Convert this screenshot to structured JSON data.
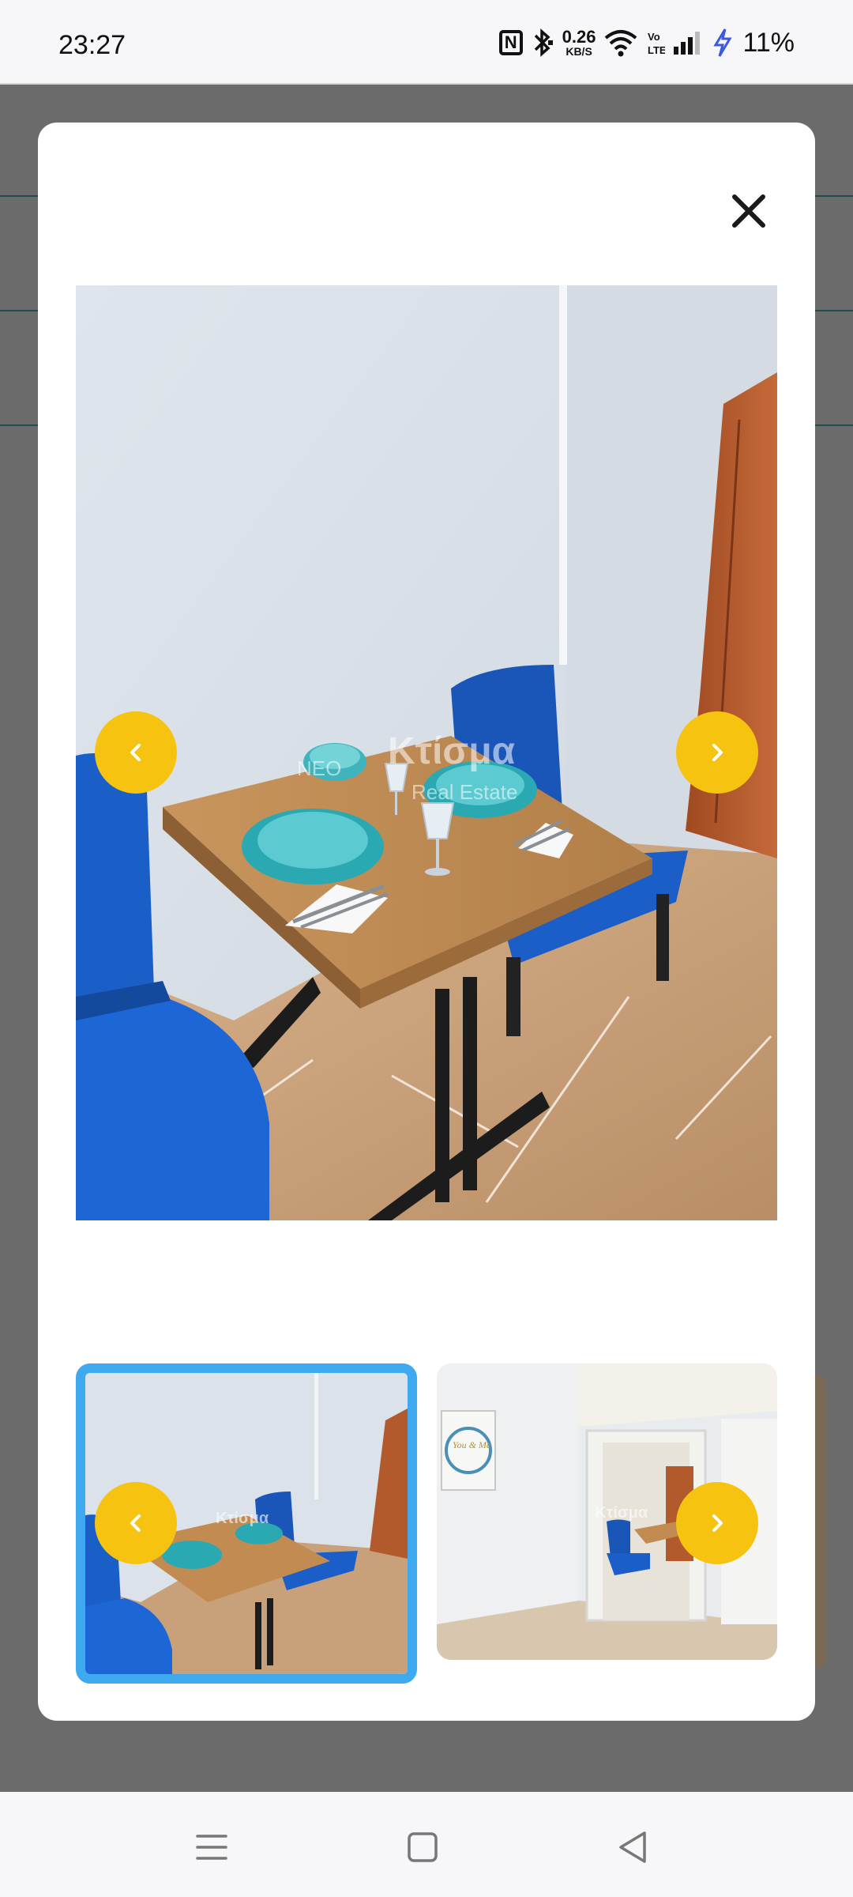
{
  "status_bar": {
    "time": "23:27",
    "speed_value": "0.26",
    "speed_unit": "KB/S",
    "battery": "11%",
    "icons": [
      "nfc-icon",
      "bluetooth-icon",
      "wifi-icon",
      "volte-icon",
      "signal-icon",
      "charging-bolt-icon"
    ],
    "nfc_glyph": "N"
  },
  "modal": {
    "close_icon": "close-icon",
    "main_photo": {
      "watermark_brand": "Κτίσμα",
      "watermark_prefix": "NEO",
      "watermark_sub": "Real Estate"
    },
    "prev_icon": "chevron-left-icon",
    "next_icon": "chevron-right-icon",
    "thumbnails": [
      {
        "name": "thumbnail-1",
        "selected": true,
        "watermark": "Κτίσμα"
      },
      {
        "name": "thumbnail-2",
        "selected": false,
        "watermark": "Κτίσμα",
        "wall_art_text": "You & Me"
      }
    ]
  },
  "colors": {
    "accent_yellow": "#f5c310",
    "selected_border": "#3fa9ef",
    "overlay": "#6b6b6b"
  },
  "nav_bar": {
    "icons": [
      "menu-icon",
      "home-square-icon",
      "back-triangle-icon"
    ]
  }
}
